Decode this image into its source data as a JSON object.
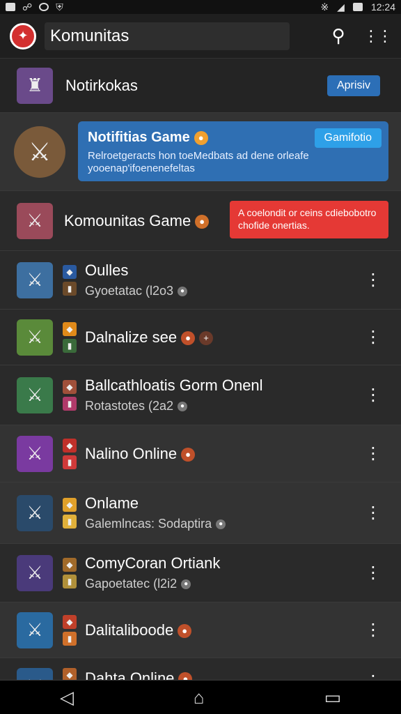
{
  "status_bar": {
    "time": "12:24",
    "left_icons": [
      "image-icon",
      "link-icon",
      "circle-icon",
      "shield-icon"
    ],
    "right_icons": [
      "bluetooth-icon",
      "signal-icon",
      "battery-icon"
    ]
  },
  "app_bar": {
    "title": "Komunitas",
    "search_icon": "search-icon",
    "more_icon": "more-icon"
  },
  "header_row": {
    "title": "Notirkokas",
    "button_label": "Aprisiv"
  },
  "blue_card": {
    "title": "Notifitias Game",
    "button_label": "Gamifotio",
    "text": "Relroetgeracts hon toeMedbats ad dene orleafe yooenap'ifoenenefeltas"
  },
  "komunitas_row": {
    "title": "Komounitas Game",
    "red_card_text": "A coelondit or ceins cdiebobotro chofide onertias."
  },
  "list": [
    {
      "title": "Oulles",
      "subtitle": "Gyoetatac (l2o3",
      "thumb_color": "#3d6fa0",
      "mini_a": "#2a5aa0",
      "mini_b": "#6b4a2a",
      "has_kebab": true
    },
    {
      "title": "Dalnalize see",
      "subtitle": "",
      "thumb_color": "#5a8a3a",
      "mini_a": "#e08a1a",
      "mini_b": "#3a6a3a",
      "has_kebab": true
    },
    {
      "title": "Ballcathloatis Gorm Onenl",
      "subtitle": "Rotastotes (2a2",
      "thumb_color": "#3a7a4a",
      "mini_a": "#a0503a",
      "mini_b": "#b03a6a",
      "has_kebab": true
    },
    {
      "title": "Nalino Online",
      "subtitle": "",
      "thumb_color": "#7a3aa0",
      "mini_a": "#c0302a",
      "mini_b": "#d03a3a",
      "has_kebab": true
    },
    {
      "title": "Onlame",
      "subtitle": "Galemlncas: Sodaptira",
      "thumb_color": "#2a4a6a",
      "mini_a": "#e0a02a",
      "mini_b": "#e0b03a",
      "has_kebab": true
    },
    {
      "title": "ComyCoran Ortiank",
      "subtitle": "Gapoetatec (l2i2",
      "thumb_color": "#4a3a7a",
      "mini_a": "#a06a2a",
      "mini_b": "#b0903a",
      "has_kebab": true
    },
    {
      "title": "Dalitaliboode",
      "subtitle": "",
      "thumb_color": "#2a6aa0",
      "mini_a": "#c0402a",
      "mini_b": "#d0702a",
      "has_kebab": true
    },
    {
      "title": "Dahta Online",
      "subtitle": "",
      "thumb_color": "#2a5a8a",
      "mini_a": "#b0602a",
      "mini_b": "#c08a2a",
      "has_kebab": true
    }
  ],
  "nav_bar": {
    "back_icon": "back-icon",
    "home_icon": "home-icon",
    "recents_icon": "recents-icon"
  }
}
